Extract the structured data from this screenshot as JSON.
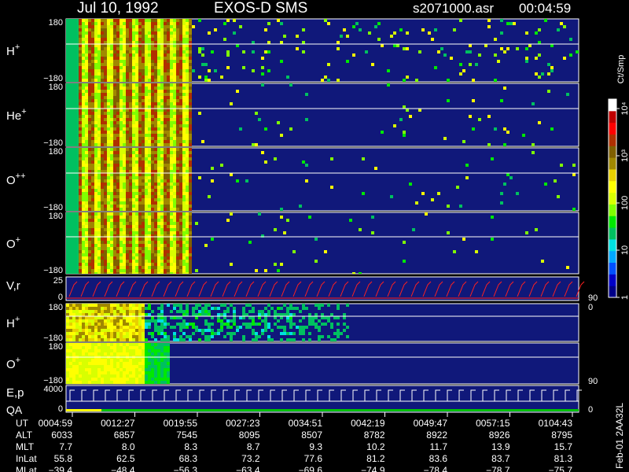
{
  "header": {
    "date": "Jul 10, 1992",
    "instrument": "EXOS-D SMS",
    "file": "s2071000.asr",
    "duration": "00:04:59"
  },
  "chart_data": {
    "type": "heatmap",
    "colorbar": {
      "unit": "Ct/Smp",
      "ticks": [
        {
          "label": "1",
          "value": 1
        },
        {
          "label": "10",
          "value": 10
        },
        {
          "label": "100",
          "value": 100
        },
        {
          "label": "10³",
          "value": 1000
        },
        {
          "label": "10⁴",
          "value": 10000
        }
      ],
      "colors": [
        "#000088",
        "#0000c8",
        "#0050ff",
        "#00a8ff",
        "#00e0e0",
        "#00c060",
        "#00e800",
        "#80ff00",
        "#d8ff00",
        "#ffff00",
        "#e8d000",
        "#a08800",
        "#806000",
        "#b03000",
        "#ff0000",
        "#c00000",
        "#ffffff"
      ]
    },
    "panels": [
      {
        "label": "H",
        "sup": "+",
        "ytop": "180",
        "ybot": "−180",
        "kind": "pitch",
        "shift": 0,
        "late": 0.9,
        "right_tick": ""
      },
      {
        "label": "He",
        "sup": "+",
        "ytop": "180",
        "ybot": "−180",
        "kind": "pitch",
        "shift": 0,
        "late": 0.35,
        "right_tick": ""
      },
      {
        "label": "O",
        "sup": "++",
        "ytop": "180",
        "ybot": "−180",
        "kind": "pitch",
        "shift": 0,
        "late": 0.3,
        "right_tick": ""
      },
      {
        "label": "O",
        "sup": "+",
        "ytop": "180",
        "ybot": "−180",
        "kind": "pitch",
        "shift": 0,
        "late": 0.3,
        "right_tick": ""
      },
      {
        "label": "V,r",
        "sup": "",
        "ytop": "25",
        "ybot": "0",
        "kind": "vr",
        "right_tick": "90",
        "right_tick_bottom": "0"
      },
      {
        "label": "H",
        "sup": "+",
        "ytop": "180",
        "ybot": "−180",
        "kind": "pitch2",
        "right_tick": ""
      },
      {
        "label": "O",
        "sup": "+",
        "ytop": "180",
        "ybot": "−180",
        "kind": "pitch3",
        "right_tick": "90"
      },
      {
        "label": "E,p",
        "sup": "",
        "label2": "QA",
        "ytop": "4000",
        "ybot": "0",
        "kind": "ep",
        "right_tick": "0"
      }
    ],
    "xaxis": {
      "rows": [
        "UT",
        "ALT",
        "MLT",
        "InLat",
        "MLat"
      ],
      "columns": [
        {
          "UT": "0004:59",
          "ALT": "6033",
          "MLT": "7.7",
          "InLat": "55.8",
          "MLat": "−39.4"
        },
        {
          "UT": "0012:27",
          "ALT": "6857",
          "MLT": "8.0",
          "InLat": "62.5",
          "MLat": "−48.4"
        },
        {
          "UT": "0019:55",
          "ALT": "7545",
          "MLT": "8.3",
          "InLat": "68.3",
          "MLat": "−56.3"
        },
        {
          "UT": "0027:23",
          "ALT": "8095",
          "MLT": "8.7",
          "InLat": "73.2",
          "MLat": "−63.4"
        },
        {
          "UT": "0034:51",
          "ALT": "8507",
          "MLT": "9.3",
          "InLat": "77.6",
          "MLat": "−69.6"
        },
        {
          "UT": "0042:19",
          "ALT": "8782",
          "MLT": "10.2",
          "InLat": "81.2",
          "MLat": "−74.9"
        },
        {
          "UT": "0049:47",
          "ALT": "8922",
          "MLT": "11.7",
          "InLat": "83.6",
          "MLat": "−78.4"
        },
        {
          "UT": "0057:15",
          "ALT": "8926",
          "MLT": "13.9",
          "InLat": "83.7",
          "MLat": "−78.7"
        },
        {
          "UT": "0104:43",
          "ALT": "8795",
          "MLT": "15.7",
          "InLat": "81.3",
          "MLat": "−75.7"
        }
      ]
    },
    "side_note": "Feb-01 2AA32L"
  }
}
